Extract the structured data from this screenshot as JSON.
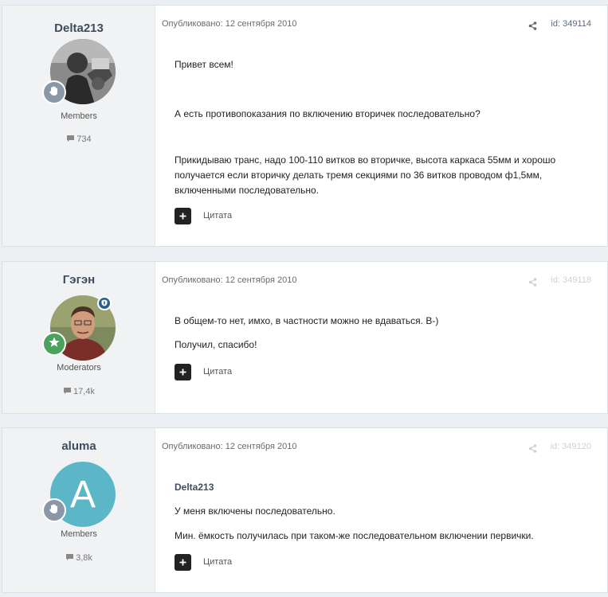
{
  "posts": [
    {
      "author": "Delta213",
      "group": "Members",
      "post_count": "734",
      "published": "Опубликовано: 12 сентября 2010",
      "id": "id: 349114",
      "paragraphs": [
        "Привет всем!",
        "А есть противопоказания по включению вторичек последовательно?",
        "Прикидываю транс, надо 100-110 витков во вторичке, высота каркаса 55мм и хорошо получается если вторичку делать тремя секциями по 36 витков проводом ф1,5мм, включенными последовательно."
      ],
      "quote_label": "Цитата"
    },
    {
      "author": "Гэгэн",
      "group": "Moderators",
      "post_count": "17,4k",
      "published": "Опубликовано: 12 сентября 2010",
      "id": "id: 349118",
      "paragraphs": [
        "В общем-то нет, имхо, в частности можно не вдаваться. B-)",
        "Получил, спасибо!"
      ],
      "quote_label": "Цитата"
    },
    {
      "author": "aluma",
      "avatar_letter": "A",
      "group": "Members",
      "post_count": "3,8k",
      "published": "Опубликовано: 12 сентября 2010",
      "id": "id: 349120",
      "quoted_author": "Delta213",
      "paragraphs": [
        "У меня включены последовательно.",
        "Мин. ёмкость получилась при таком-же последовательном включении первички."
      ],
      "quote_label": "Цитата"
    }
  ],
  "colors": {
    "background": "#ebeef2",
    "author_panel": "#f1f2f4",
    "name_color": "#3d4d5f",
    "rank_badge_gray": "#8a97a6",
    "rank_badge_green": "#4aa35b",
    "mod_badge": "#2c5f8d",
    "letter_avatar": "#5bb7c8"
  },
  "icons": [
    "comment-icon",
    "share-icon",
    "plus-icon",
    "hand-badge-icon",
    "star-badge-icon",
    "shield-icon"
  ]
}
